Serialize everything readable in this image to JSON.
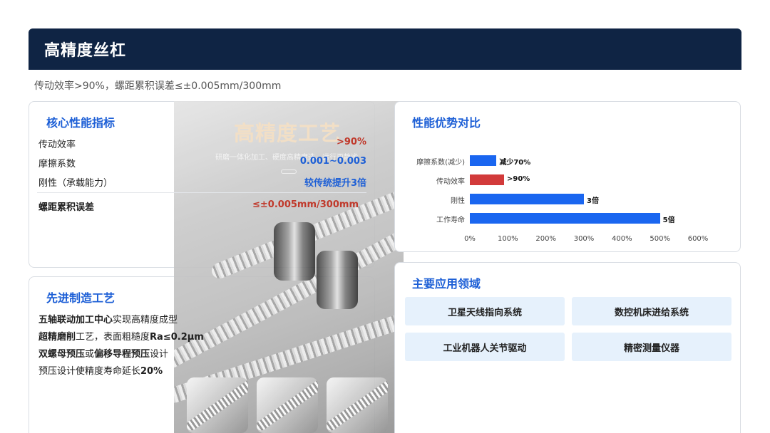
{
  "header": {
    "title": "高精度丝杠"
  },
  "subtitle": "传动效率>90%，螺距累积误差≤±0.005mm/300mm",
  "metrics": {
    "title": "核心性能指标",
    "items": [
      {
        "label": "传动效率",
        "value": ">90%",
        "color": "#c0392b"
      },
      {
        "label": "摩擦系数",
        "value": "0.001~0.003",
        "color": "#1d5fd6"
      },
      {
        "label": "刚性（承载能力）",
        "value": "较传统提升3倍",
        "color": "#1d5fd6"
      },
      {
        "label": "螺距累积误差",
        "value": "≤±0.005mm/300mm",
        "color": "#c0392b"
      }
    ]
  },
  "photo": {
    "title": "高精度工艺",
    "subtitle": "研磨一体化加工、硬度高精度选、运行更静谧"
  },
  "craft": {
    "title": "先进制造工艺",
    "lines": [
      {
        "bold1": "五轴联动加工中心",
        "text1": "实现高精度成型",
        "bold2": "",
        "text2": ""
      },
      {
        "bold1": "超精磨削",
        "text1": "工艺，表面粗糙度",
        "bold2": "Ra≤0.2μm",
        "text2": ""
      },
      {
        "bold1": "双螺母预压",
        "text1": "或",
        "bold2": "偏移导程预压",
        "text2": "设计"
      },
      {
        "bold1": "",
        "text1": "预压设计使精度寿命延长",
        "bold2": "20%",
        "text2": ""
      }
    ]
  },
  "chart_title": "性能优势对比",
  "chart_data": {
    "type": "bar",
    "orientation": "horizontal",
    "categories": [
      "摩擦系数(减少)",
      "传动效率",
      "刚性",
      "工作寿命"
    ],
    "values": [
      70,
      90,
      300,
      500
    ],
    "value_labels": [
      "减少70%",
      ">90%",
      "3倍",
      "5倍"
    ],
    "colors": [
      "#1a66f0",
      "#d23a3a",
      "#1a66f0",
      "#1a66f0"
    ],
    "xlim": [
      0,
      600
    ],
    "xticks": [
      "0%",
      "100%",
      "200%",
      "300%",
      "400%",
      "500%",
      "600%"
    ]
  },
  "apps": {
    "title": "主要应用领域",
    "items": [
      "卫星天线指向系统",
      "数控机床进给系统",
      "工业机器人关节驱动",
      "精密测量仪器"
    ]
  }
}
